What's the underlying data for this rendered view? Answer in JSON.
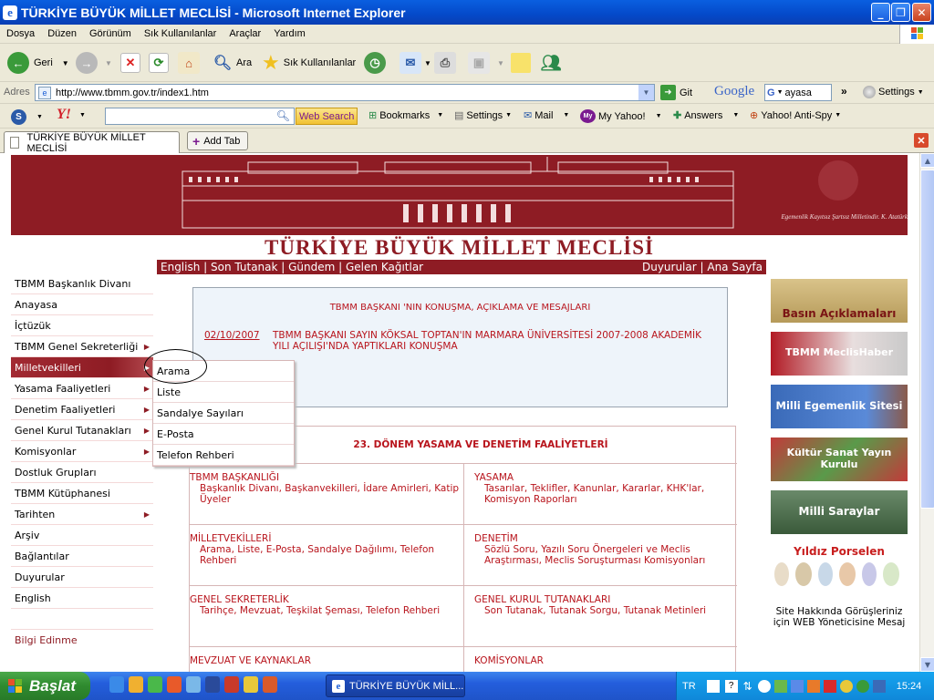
{
  "window": {
    "title": "TÜRKİYE BÜYÜK MİLLET MECLİSİ - Microsoft Internet Explorer"
  },
  "menubar": [
    "Dosya",
    "Düzen",
    "Görünüm",
    "Sık Kullanılanlar",
    "Araçlar",
    "Yardım"
  ],
  "toolbar": {
    "back": "Geri",
    "search": "Ara",
    "favorites": "Sık Kullanılanlar"
  },
  "address": {
    "label": "Adres",
    "url": "http://www.tbmm.gov.tr/index1.htm",
    "go": "Git",
    "google_logo": "Google",
    "google_query": "ayasa",
    "settings": "Settings"
  },
  "yahoo": {
    "search_button": "Web Search",
    "bookmarks": "Bookmarks",
    "settings": "Settings",
    "mail": "Mail",
    "myyahoo": "My Yahoo!",
    "answers": "Answers",
    "antispy": "Yahoo! Anti-Spy"
  },
  "tabs": {
    "current": "TÜRKİYE BÜYÜK MİLLET MECLİSİ",
    "add": "Add Tab"
  },
  "site": {
    "banner_quote": "Egemenlik Kayıtsız Şartsız Milletindir. K. Atatürk",
    "title": "TÜRKİYE BÜYÜK MİLLET MECLİSİ",
    "topnav_left": "English | Son Tutanak | Gündem | Gelen Kağıtlar",
    "topnav_right": "Duyurular | Ana Sayfa",
    "left_menu": [
      {
        "label": "TBMM Başkanlık Divanı",
        "arrow": false
      },
      {
        "label": "Anayasa",
        "arrow": false
      },
      {
        "label": "İçtüzük",
        "arrow": false
      },
      {
        "label": "TBMM Genel Sekreterliği",
        "arrow": true
      },
      {
        "label": "Milletvekilleri",
        "arrow": true
      },
      {
        "label": "Yasama Faaliyetleri",
        "arrow": true
      },
      {
        "label": "Denetim Faaliyetleri",
        "arrow": true
      },
      {
        "label": "Genel Kurul Tutanakları",
        "arrow": true
      },
      {
        "label": "Komisyonlar",
        "arrow": true
      },
      {
        "label": "Dostluk Grupları",
        "arrow": false
      },
      {
        "label": "TBMM Kütüphanesi",
        "arrow": false
      },
      {
        "label": "Tarihten",
        "arrow": true
      },
      {
        "label": "Arşiv",
        "arrow": false
      },
      {
        "label": "Bağlantılar",
        "arrow": false
      },
      {
        "label": "Duyurular",
        "arrow": false
      },
      {
        "label": "English",
        "arrow": false
      },
      {
        "label": "",
        "arrow": false
      },
      {
        "label": "Bilgi Edinme",
        "arrow": false
      }
    ],
    "submenu": [
      "Arama",
      "Liste",
      "Sandalye Sayıları",
      "E-Posta",
      "Telefon Rehberi"
    ],
    "news_heading": "TBMM BAŞKANI 'NIN KONUŞMA, AÇIKLAMA VE MESAJLARI",
    "news_date": "02/10/2007",
    "news_text": "TBMM BAŞKANI SAYIN KÖKSAL TOPTAN'IN MARMARA ÜNİVERSİTESİ 2007-2008 AKADEMİK YILI AÇILIŞI'NDA YAPTIKLARI KONUŞMA",
    "activities_heading": "23. DÖNEM YASAMA VE DENETİM FAALİYETLERİ",
    "activities": [
      {
        "title": "TBMM BAŞKANLIĞI",
        "desc": "Başkanlık Divanı, Başkanvekilleri, İdare Amirleri, Katip Üyeler"
      },
      {
        "title": "YASAMA",
        "desc": "Tasarılar, Teklifler, Kanunlar, Kararlar, KHK'lar, Komisyon Raporları"
      },
      {
        "title": "MİLLETVEKİLLERİ",
        "desc": "Arama, Liste, E-Posta, Sandalye Dağılımı, Telefon Rehberi"
      },
      {
        "title": "DENETİM",
        "desc": "Sözlü Soru, Yazılı Soru Önergeleri ve Meclis Araştırması, Meclis Soruşturması Komisyonları"
      },
      {
        "title": "GENEL SEKRETERLİK",
        "desc": "Tarihçe, Mevzuat, Teşkilat Şeması, Telefon Rehberi"
      },
      {
        "title": "GENEL KURUL TUTANAKLARI",
        "desc": "Son Tutanak, Tutanak Sorgu, Tutanak Metinleri"
      },
      {
        "title": "MEVZUAT VE KAYNAKLAR",
        "desc": ""
      },
      {
        "title": "KOMİSYONLAR",
        "desc": ""
      }
    ],
    "right_banners": [
      "Basın Açıklamaları",
      "TBMM MeclisHaber",
      "Milli Egemenlik Sitesi",
      "Kültür Sanat Yayın Kurulu",
      "Milli Saraylar",
      "Yıldız Porselen"
    ],
    "site_feedback": "Site Hakkında Görüşleriniz için WEB Yöneticisine Mesaj"
  },
  "taskbar": {
    "start": "Başlat",
    "item": "TÜRKİYE BÜYÜK MİLL...",
    "lang": "TR",
    "clock": "15:24"
  }
}
